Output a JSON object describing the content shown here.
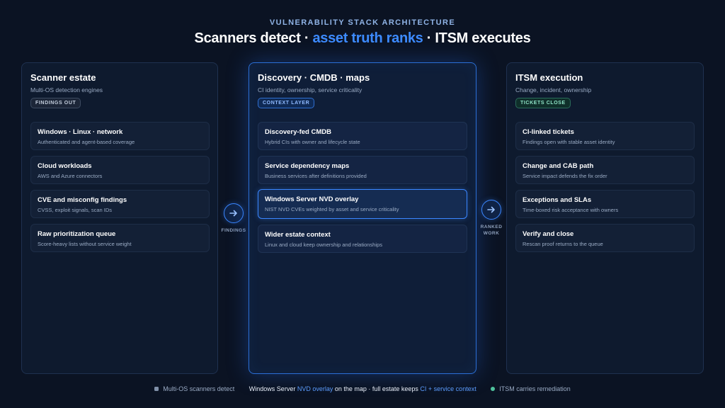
{
  "header": {
    "eyebrow": "VULNERABILITY STACK ARCHITECTURE",
    "title_part1": "Scanners detect · ",
    "title_accent": "asset truth ranks",
    "title_part2": " · ITSM executes"
  },
  "panels": [
    {
      "title": "Scanner estate",
      "subtitle": "Multi-OS detection engines",
      "badge": "FINDINGS OUT",
      "cards": [
        {
          "title": "Windows · Linux · network",
          "desc": "Authenticated and agent-based coverage"
        },
        {
          "title": "Cloud workloads",
          "desc": "AWS and Azure connectors"
        },
        {
          "title": "CVE and misconfig findings",
          "desc": "CVSS, exploit signals, scan IDs"
        },
        {
          "title": "Raw prioritization queue",
          "desc": "Score-heavy lists without service weight"
        }
      ]
    },
    {
      "title": "Discovery · CMDB · maps",
      "subtitle": "CI identity, ownership, service criticality",
      "badge": "CONTEXT LAYER",
      "cards": [
        {
          "title": "Discovery-fed CMDB",
          "desc": "Hybrid CIs with owner and lifecycle state"
        },
        {
          "title": "Service dependency maps",
          "desc": "Business services after definitions provided"
        },
        {
          "title": "Windows Server NVD overlay",
          "desc": "NIST NVD CVEs weighted by asset and service criticality"
        },
        {
          "title": "Wider estate context",
          "desc": "Linux and cloud keep ownership and relationships"
        }
      ]
    },
    {
      "title": "ITSM execution",
      "subtitle": "Change, incident, ownership",
      "badge": "TICKETS CLOSE",
      "cards": [
        {
          "title": "CI-linked tickets",
          "desc": "Findings open with stable asset identity"
        },
        {
          "title": "Change and CAB path",
          "desc": "Service impact defends the fix order"
        },
        {
          "title": "Exceptions and SLAs",
          "desc": "Time-boxed risk acceptance with owners"
        },
        {
          "title": "Verify and close",
          "desc": "Rescan proof returns to the queue"
        }
      ]
    }
  ],
  "connectors": [
    {
      "label_line1": "FINDINGS",
      "label_line2": ""
    },
    {
      "label_line1": "RANKED",
      "label_line2": "WORK"
    }
  ],
  "footer": {
    "left": "Multi-OS scanners detect",
    "mid_part1": "Windows Server ",
    "mid_hl1": "NVD overlay",
    "mid_part2": " on the map · full estate keeps ",
    "mid_hl2": "CI + service context",
    "right": "ITSM carries remediation"
  },
  "colors": {
    "background": "#0b1323",
    "accent": "#3d8bff",
    "badge_green": "#8fe3c6",
    "icons": [
      "arrow-right-icon"
    ]
  }
}
